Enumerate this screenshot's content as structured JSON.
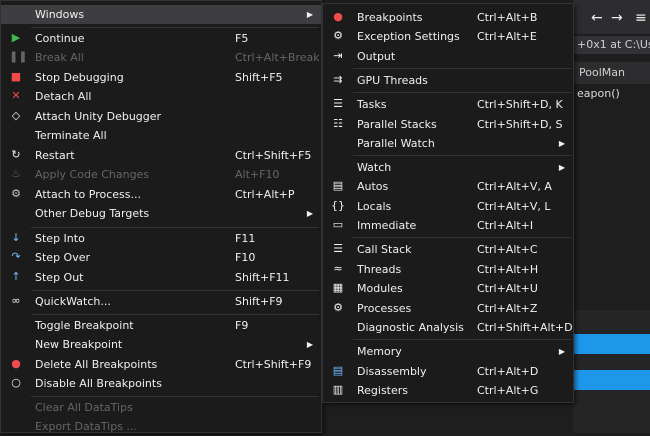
{
  "background": {
    "toolbar_arrows": [
      "←",
      "→",
      "≡"
    ],
    "location_text": "+0x1 at C:\\Us",
    "tab_label": "PoolMan",
    "code_line": "eapon()"
  },
  "debug_menu": {
    "header": "Windows",
    "items": [
      {
        "label": "Continue",
        "shortcut": "F5",
        "icon": "play-icon"
      },
      {
        "label": "Break All",
        "shortcut": "Ctrl+Alt+Break",
        "icon": "pause-icon",
        "disabled": true
      },
      {
        "label": "Stop Debugging",
        "shortcut": "Shift+F5",
        "icon": "stop-icon"
      },
      {
        "label": "Detach All",
        "shortcut": "",
        "icon": "detach-icon"
      },
      {
        "label": "Attach Unity Debugger",
        "shortcut": "",
        "icon": "unity-icon"
      },
      {
        "label": "Terminate All",
        "shortcut": ""
      },
      {
        "label": "Restart",
        "shortcut": "Ctrl+Shift+F5",
        "icon": "restart-icon"
      },
      {
        "label": "Apply Code Changes",
        "shortcut": "Alt+F10",
        "icon": "fire-icon",
        "disabled": true
      },
      {
        "label": "Attach to Process...",
        "shortcut": "Ctrl+Alt+P",
        "icon": "gears-icon"
      },
      {
        "label": "Other Debug Targets",
        "shortcut": "",
        "submenu": true
      },
      {
        "label": "Step Into",
        "shortcut": "F11",
        "icon": "step-into-icon"
      },
      {
        "label": "Step Over",
        "shortcut": "F10",
        "icon": "step-over-icon"
      },
      {
        "label": "Step Out",
        "shortcut": "Shift+F11",
        "icon": "step-out-icon"
      },
      {
        "label": "QuickWatch...",
        "shortcut": "Shift+F9",
        "icon": "glasses-icon"
      },
      {
        "label": "Toggle Breakpoint",
        "shortcut": "F9"
      },
      {
        "label": "New Breakpoint",
        "shortcut": "",
        "submenu": true
      },
      {
        "label": "Delete All Breakpoints",
        "shortcut": "Ctrl+Shift+F9",
        "icon": "delete-breakpoints-icon"
      },
      {
        "label": "Disable All Breakpoints",
        "shortcut": "",
        "icon": "disable-breakpoints-icon"
      },
      {
        "label": "Clear All DataTips",
        "shortcut": "",
        "disabled": true
      },
      {
        "label": "Export DataTips ...",
        "shortcut": "",
        "disabled": true
      }
    ]
  },
  "windows_submenu": {
    "items": [
      {
        "label": "Breakpoints",
        "shortcut": "Ctrl+Alt+B",
        "icon": "breakpoints-icon"
      },
      {
        "label": "Exception Settings",
        "shortcut": "Ctrl+Alt+E",
        "icon": "exception-icon"
      },
      {
        "label": "Output",
        "shortcut": "",
        "icon": "output-icon"
      },
      {
        "label": "GPU Threads",
        "shortcut": "",
        "icon": "gpu-threads-icon"
      },
      {
        "label": "Tasks",
        "shortcut": "Ctrl+Shift+D, K",
        "icon": "tasks-icon"
      },
      {
        "label": "Parallel Stacks",
        "shortcut": "Ctrl+Shift+D, S",
        "icon": "parallel-stacks-icon"
      },
      {
        "label": "Parallel Watch",
        "shortcut": "",
        "submenu": true
      },
      {
        "label": "Watch",
        "shortcut": "",
        "submenu": true
      },
      {
        "label": "Autos",
        "shortcut": "Ctrl+Alt+V, A",
        "icon": "autos-icon"
      },
      {
        "label": "Locals",
        "shortcut": "Ctrl+Alt+V, L",
        "icon": "locals-icon"
      },
      {
        "label": "Immediate",
        "shortcut": "Ctrl+Alt+I",
        "icon": "immediate-icon"
      },
      {
        "label": "Call Stack",
        "shortcut": "Ctrl+Alt+C",
        "icon": "call-stack-icon"
      },
      {
        "label": "Threads",
        "shortcut": "Ctrl+Alt+H",
        "icon": "threads-icon"
      },
      {
        "label": "Modules",
        "shortcut": "Ctrl+Alt+U",
        "icon": "modules-icon"
      },
      {
        "label": "Processes",
        "shortcut": "Ctrl+Alt+Z",
        "icon": "processes-icon"
      },
      {
        "label": "Diagnostic Analysis",
        "shortcut": "Ctrl+Shift+Alt+D",
        "icon": ""
      },
      {
        "label": "Memory",
        "shortcut": "",
        "submenu": true
      },
      {
        "label": "Disassembly",
        "shortcut": "Ctrl+Alt+D",
        "icon": "disassembly-icon"
      },
      {
        "label": "Registers",
        "shortcut": "Ctrl+Alt+G",
        "icon": "registers-icon"
      }
    ]
  },
  "colors": {
    "menu_bg": "#1b1b1c",
    "highlight": "#3e3e40",
    "disabled_text": "#656565",
    "accent_blue": "#1c97ea"
  }
}
